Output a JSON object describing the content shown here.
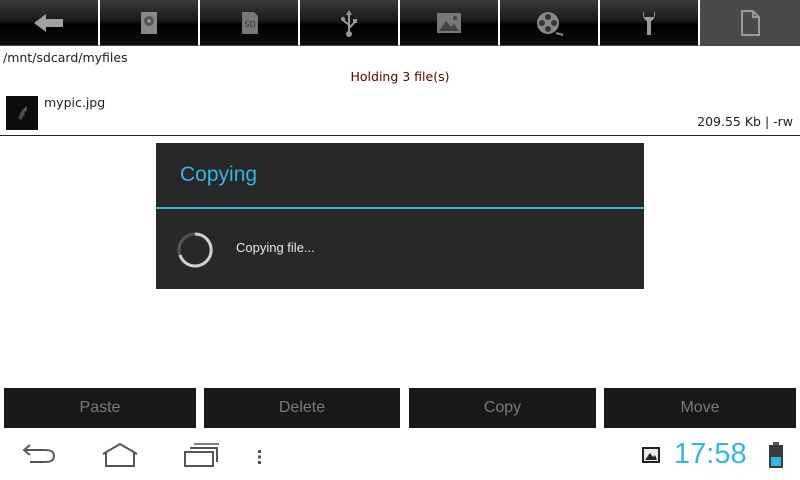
{
  "toolbar": {
    "buttons": [
      {
        "icon": "back-arrow-icon"
      },
      {
        "icon": "sdcard-disk-icon"
      },
      {
        "icon": "sdcard-icon",
        "label": "SD"
      },
      {
        "icon": "usb-icon"
      },
      {
        "icon": "image-icon"
      },
      {
        "icon": "film-reel-icon"
      },
      {
        "icon": "wrench-icon"
      },
      {
        "icon": "file-icon"
      }
    ]
  },
  "path": "/mnt/sdcard/myfiles",
  "holding": "Holding 3 file(s)",
  "file": {
    "name": "mypic.jpg",
    "meta": "209.55 Kb  | -rw"
  },
  "dialog": {
    "title": "Copying",
    "message": "Copying file..."
  },
  "actions": {
    "paste": "Paste",
    "delete": "Delete",
    "copy": "Copy",
    "move": "Move"
  },
  "status": {
    "time": "17:58"
  },
  "colors": {
    "accent": "#33b5e5",
    "holding_text": "#5a0000",
    "dialog_bg": "#282828",
    "button_bg": "#181818"
  }
}
